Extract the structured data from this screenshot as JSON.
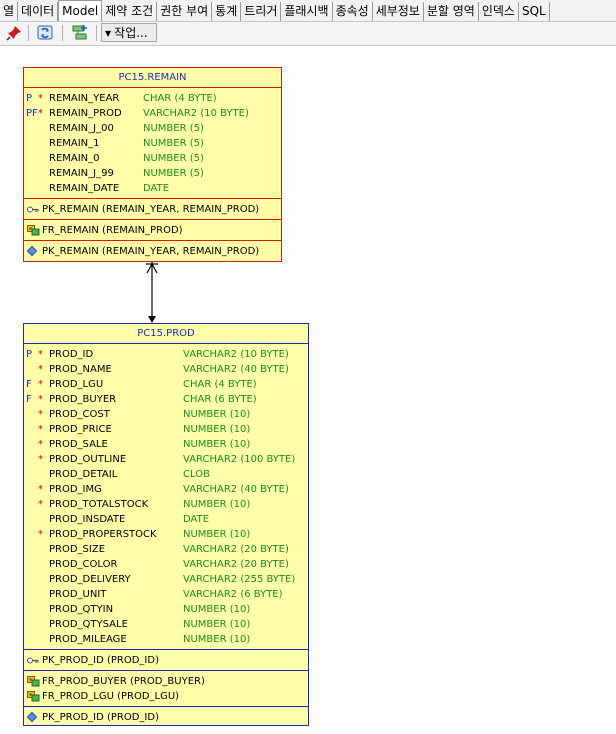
{
  "tabs": [
    "열",
    "데이터",
    "Model",
    "제약 조건",
    "권한 부여",
    "통계",
    "트리거",
    "플래시백",
    "종속성",
    "세부정보",
    "분할 영역",
    "인덱스",
    "SQL"
  ],
  "toolbar": {
    "pin_icon": "pin-icon",
    "refresh_icon": "refresh-icon",
    "layout_icon": "layout-icon",
    "action_label": "작업..."
  },
  "diagram": {
    "remain": {
      "title": "PC15.REMAIN",
      "columns": [
        {
          "flag": "P",
          "req": "*",
          "name": "REMAIN_YEAR",
          "type": "CHAR (4 BYTE)"
        },
        {
          "flag": "PF",
          "req": "*",
          "name": "REMAIN_PROD",
          "type": "VARCHAR2 (10 BYTE)"
        },
        {
          "flag": "",
          "req": "",
          "name": "REMAIN_J_00",
          "type": "NUMBER (5)"
        },
        {
          "flag": "",
          "req": "",
          "name": "REMAIN_1",
          "type": "NUMBER (5)"
        },
        {
          "flag": "",
          "req": "",
          "name": "REMAIN_0",
          "type": "NUMBER (5)"
        },
        {
          "flag": "",
          "req": "",
          "name": "REMAIN_J_99",
          "type": "NUMBER (5)"
        },
        {
          "flag": "",
          "req": "",
          "name": "REMAIN_DATE",
          "type": "DATE"
        }
      ],
      "pk": [
        "PK_REMAIN (REMAIN_YEAR, REMAIN_PROD)"
      ],
      "fk": [
        "FR_REMAIN (REMAIN_PROD)"
      ],
      "idx": [
        "PK_REMAIN (REMAIN_YEAR, REMAIN_PROD)"
      ]
    },
    "prod": {
      "title": "PC15.PROD",
      "columns": [
        {
          "flag": "P",
          "req": "*",
          "name": "PROD_ID",
          "type": "VARCHAR2 (10 BYTE)"
        },
        {
          "flag": "",
          "req": "*",
          "name": "PROD_NAME",
          "type": "VARCHAR2 (40 BYTE)"
        },
        {
          "flag": "F",
          "req": "*",
          "name": "PROD_LGU",
          "type": "CHAR (4 BYTE)"
        },
        {
          "flag": "F",
          "req": "*",
          "name": "PROD_BUYER",
          "type": "CHAR (6 BYTE)"
        },
        {
          "flag": "",
          "req": "*",
          "name": "PROD_COST",
          "type": "NUMBER (10)"
        },
        {
          "flag": "",
          "req": "*",
          "name": "PROD_PRICE",
          "type": "NUMBER (10)"
        },
        {
          "flag": "",
          "req": "*",
          "name": "PROD_SALE",
          "type": "NUMBER (10)"
        },
        {
          "flag": "",
          "req": "*",
          "name": "PROD_OUTLINE",
          "type": "VARCHAR2 (100 BYTE)"
        },
        {
          "flag": "",
          "req": "",
          "name": "PROD_DETAIL",
          "type": "CLOB"
        },
        {
          "flag": "",
          "req": "*",
          "name": "PROD_IMG",
          "type": "VARCHAR2 (40 BYTE)"
        },
        {
          "flag": "",
          "req": "*",
          "name": "PROD_TOTALSTOCK",
          "type": "NUMBER (10)"
        },
        {
          "flag": "",
          "req": "",
          "name": "PROD_INSDATE",
          "type": "DATE"
        },
        {
          "flag": "",
          "req": "*",
          "name": "PROD_PROPERSTOCK",
          "type": "NUMBER (10)"
        },
        {
          "flag": "",
          "req": "",
          "name": "PROD_SIZE",
          "type": "VARCHAR2 (20 BYTE)"
        },
        {
          "flag": "",
          "req": "",
          "name": "PROD_COLOR",
          "type": "VARCHAR2 (20 BYTE)"
        },
        {
          "flag": "",
          "req": "",
          "name": "PROD_DELIVERY",
          "type": "VARCHAR2 (255 BYTE)"
        },
        {
          "flag": "",
          "req": "",
          "name": "PROD_UNIT",
          "type": "VARCHAR2 (6 BYTE)"
        },
        {
          "flag": "",
          "req": "",
          "name": "PROD_QTYIN",
          "type": "NUMBER (10)"
        },
        {
          "flag": "",
          "req": "",
          "name": "PROD_QTYSALE",
          "type": "NUMBER (10)"
        },
        {
          "flag": "",
          "req": "",
          "name": "PROD_MILEAGE",
          "type": "NUMBER (10)"
        }
      ],
      "pk": [
        "PK_PROD_ID (PROD_ID)"
      ],
      "fk": [
        "FR_PROD_BUYER (PROD_BUYER)",
        "FR_PROD_LGU (PROD_LGU)"
      ],
      "idx": [
        "PK_PROD_ID (PROD_ID)"
      ]
    }
  },
  "colors": {
    "table_fill": "#ffffaa",
    "remain_border": "#cc2200",
    "prod_border": "#1f2bb5",
    "type_text": "#1e8c1e",
    "required_mark": "#d00000"
  }
}
